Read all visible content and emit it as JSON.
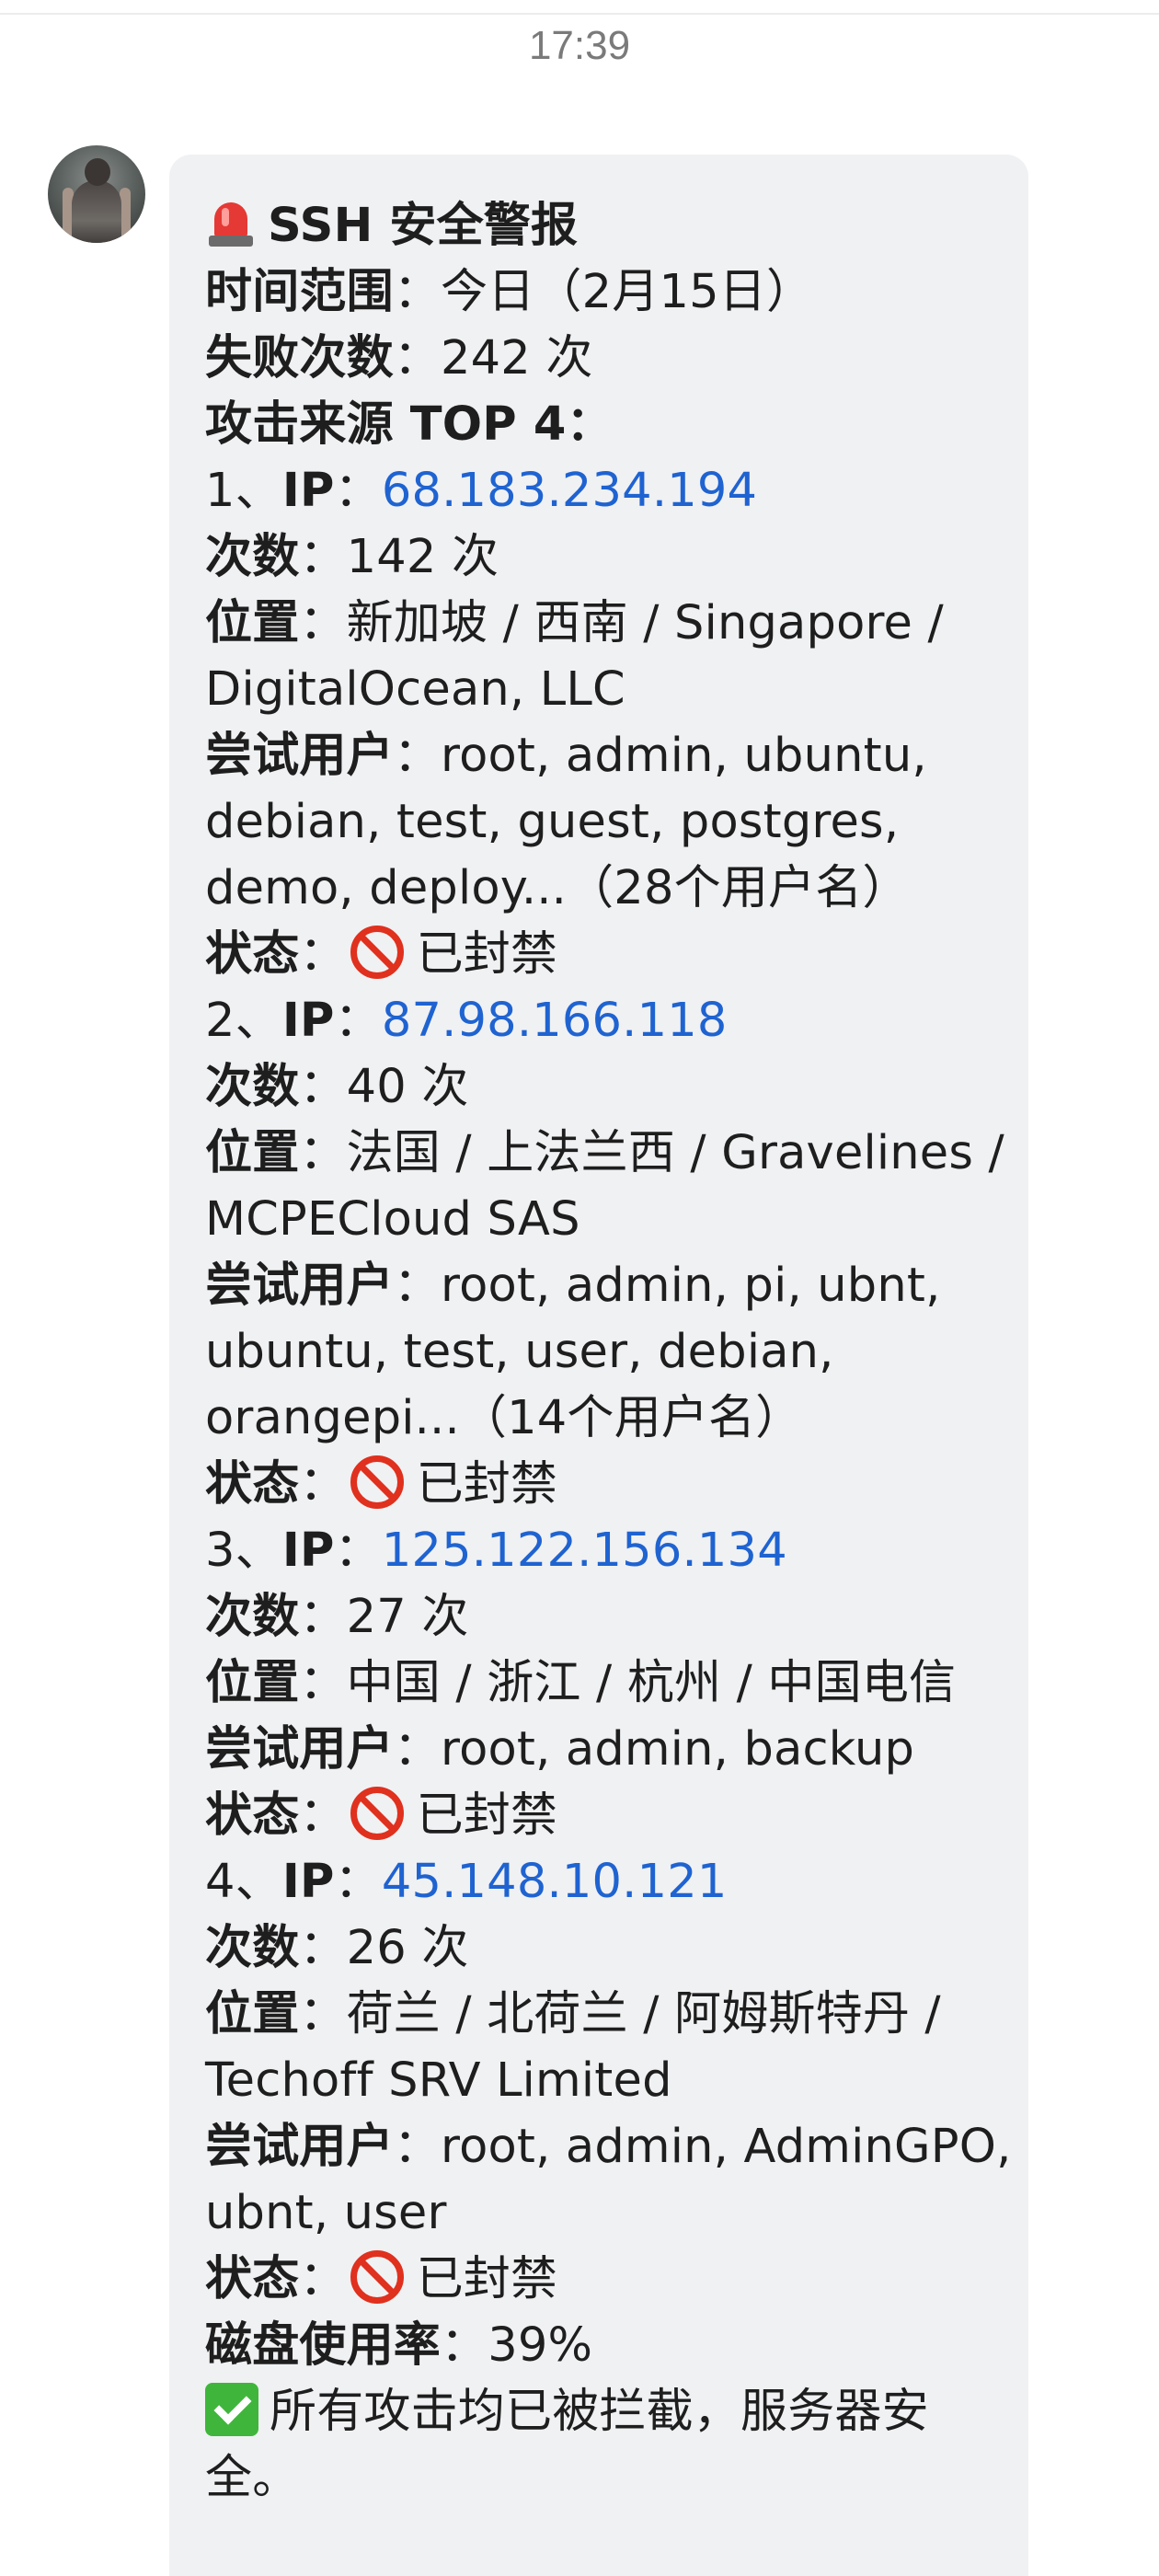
{
  "chat": {
    "timestamp": "17:39"
  },
  "message": {
    "title": "SSH 安全警报",
    "icons": {
      "alert": "siren-icon",
      "blocked": "prohibited-icon",
      "ok": "check-mark-icon"
    },
    "time_range_label": "时间范围",
    "time_range_value": "今日（2月15日）",
    "fail_count_label": "失败次数",
    "fail_count_value": "242 次",
    "top_sources_label": "攻击来源 TOP 4",
    "disk_label": "磁盘使用率",
    "disk_value": "39%",
    "footer_text": "所有攻击均已被拦截，服务器安全。",
    "labels": {
      "ip": "IP",
      "count": "次数",
      "location": "位置",
      "users": "尝试用户",
      "status": "状态"
    },
    "sources": [
      {
        "index": "1、",
        "ip": "68.183.234.194",
        "count": "142 次",
        "location": "新加坡 / 西南 / Singapore / DigitalOcean, LLC",
        "users": "root, admin, ubuntu, debian, test, guest, postgres, demo, deploy...（28个用户名）",
        "status": "已封禁"
      },
      {
        "index": "2、",
        "ip": "87.98.166.118",
        "count": "40 次",
        "location": "法国 / 上法兰西 / Gravelines / MCPECloud SAS",
        "users": "root, admin, pi, ubnt, ubuntu, test, user, debian, orangepi...（14个用户名）",
        "status": "已封禁"
      },
      {
        "index": "3、",
        "ip": "125.122.156.134",
        "count": "27 次",
        "location": "中国 / 浙江 / 杭州 / 中国电信",
        "users": "root, admin, backup",
        "status": "已封禁"
      },
      {
        "index": "4、",
        "ip": "45.148.10.121",
        "count": "26 次",
        "location": "荷兰 / 北荷兰 / 阿姆斯特丹 / Techoff SRV Limited",
        "users": "root, admin, AdminGPO, ubnt, user",
        "status": "已封禁"
      }
    ],
    "colors": {
      "bubble": "#f0f1f3",
      "link": "#1f63d1",
      "blocked": "#e0301e",
      "ok": "#3fb63b"
    }
  }
}
